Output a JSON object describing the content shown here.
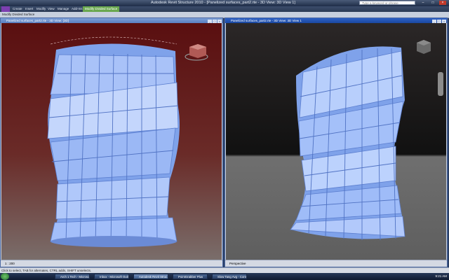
{
  "app": {
    "title": "Autodesk Revit Structure 2010 - [Panelized surfaces_part2.rte - 3D View: 3D View 1]",
    "search_placeholder": "Type a keyword or phrase",
    "window_buttons": [
      "–",
      "□",
      "×"
    ]
  },
  "ribbon": {
    "tabs": [
      "Create",
      "Insert",
      "Modify",
      "View",
      "Manage",
      "Add-Ins",
      "Modify Divided Surface"
    ],
    "context_label": "Modify Divided Surface"
  },
  "views": {
    "left": {
      "title": "Panelized surfaces_part2.rte - 3D View: {3D}",
      "scale": "1 : 200"
    },
    "right": {
      "title": "Panelized surfaces_part2.rte - 3D View: 3D View 1",
      "scale": "Perspective"
    }
  },
  "status": {
    "text": "Click to select, TAB for alternates, CTRL adds, SHIFT unselects."
  },
  "taskbar": {
    "items": [
      "Arch 1 Tech - Microsoft",
      "Inbox - Microsoft Outl...",
      "Autodesk Revit Struc...",
      "PointGrabber Plus",
      "Slow Tang Avg - Cons..."
    ],
    "clock": "9:21 AM"
  },
  "colors": {
    "panel_light": "#bcd0fb",
    "panel_mid": "#8fb0f2",
    "panel_dark": "#5c7fd0",
    "left_bg_top": "#5a0f10",
    "right_bg_top": "#0e0e0e",
    "floor": "#6e6e6e"
  }
}
